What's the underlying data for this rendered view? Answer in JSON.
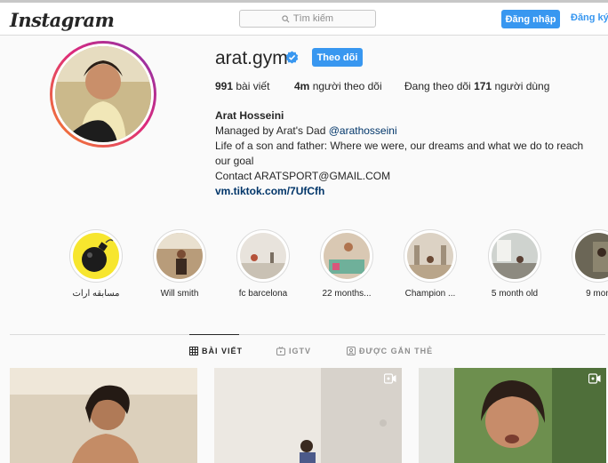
{
  "header": {
    "logo": "Instagram",
    "search_placeholder": "Tìm kiếm",
    "login_label": "Đăng nhập",
    "signup_label": "Đăng ký"
  },
  "profile": {
    "username": "arat.gym",
    "follow_label": "Theo dõi",
    "stats": {
      "posts_count": "991",
      "posts_label": "bài viết",
      "followers_count": "4m",
      "followers_label": "người theo dõi",
      "following_prefix": "Đang theo dõi",
      "following_count": "171",
      "following_suffix": "người dùng"
    },
    "bio": {
      "full_name": "Arat Hosseini",
      "managed_prefix": "Managed by Arat's Dad",
      "mention": "@arathosseini",
      "line_life": "Life of a son and father: Where we were, our dreams and what we do to reach our goal",
      "contact": "Contact ARATSPORT@GMAIL.COM",
      "link": "vm.tiktok.com/7UfCfh"
    }
  },
  "highlights": [
    {
      "label": "مسابقه آرات"
    },
    {
      "label": "Will smith"
    },
    {
      "label": "fc barcelona"
    },
    {
      "label": "22 months..."
    },
    {
      "label": "Champion ..."
    },
    {
      "label": "5 month old"
    },
    {
      "label": "9 mon"
    }
  ],
  "tabs": {
    "posts": "BÀI VIẾT",
    "igtv": "IGTV",
    "tagged": "ĐƯỢC GẮN THẺ"
  },
  "colors": {
    "accent": "#3897f0",
    "link": "#003569",
    "text": "#262626",
    "muted": "#8e8e8e"
  }
}
